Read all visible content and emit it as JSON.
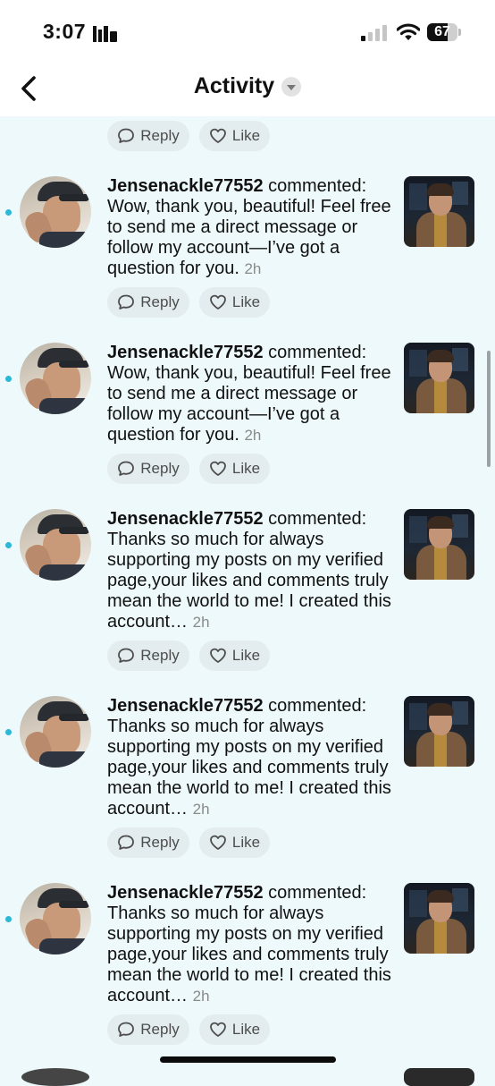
{
  "status_bar": {
    "time": "3:07",
    "battery_level": "67",
    "battery_fraction": 0.67,
    "icons": [
      "carrier-bars-icon",
      "signal-icon",
      "wifi-icon",
      "battery-icon"
    ]
  },
  "header": {
    "title": "Activity",
    "back_icon": "chevron-left-icon",
    "dropdown_icon": "chevron-down-icon"
  },
  "actions": {
    "reply_label": "Reply",
    "like_label": "Like"
  },
  "notifications": [
    {
      "username": "Jensenackle77552",
      "action": "commented:",
      "text": "Wow, thank you, beautiful! Feel free to send me a direct message or follow my account—I’ve got a question for you.",
      "time": "2h",
      "unread": true
    },
    {
      "username": "Jensenackle77552",
      "action": "commented:",
      "text": "Wow, thank you, beautiful! Feel free to send me a direct message or follow my account—I’ve got a question for you.",
      "time": "2h",
      "unread": true
    },
    {
      "username": "Jensenackle77552",
      "action": "commented:",
      "text": "Thanks so much for always supporting my posts on my verified page,your likes and comments truly mean the world to me! I created this account…",
      "time": "2h",
      "unread": true
    },
    {
      "username": "Jensenackle77552",
      "action": "commented:",
      "text": "Thanks so much for always supporting my posts on my verified page,your likes and comments truly mean the world to me! I created this account…",
      "time": "2h",
      "unread": true
    },
    {
      "username": "Jensenackle77552",
      "action": "commented:",
      "text": "Thanks so much for always supporting my posts on my verified page,your likes and comments truly mean the world to me! I created this account…",
      "time": "2h",
      "unread": true
    }
  ]
}
